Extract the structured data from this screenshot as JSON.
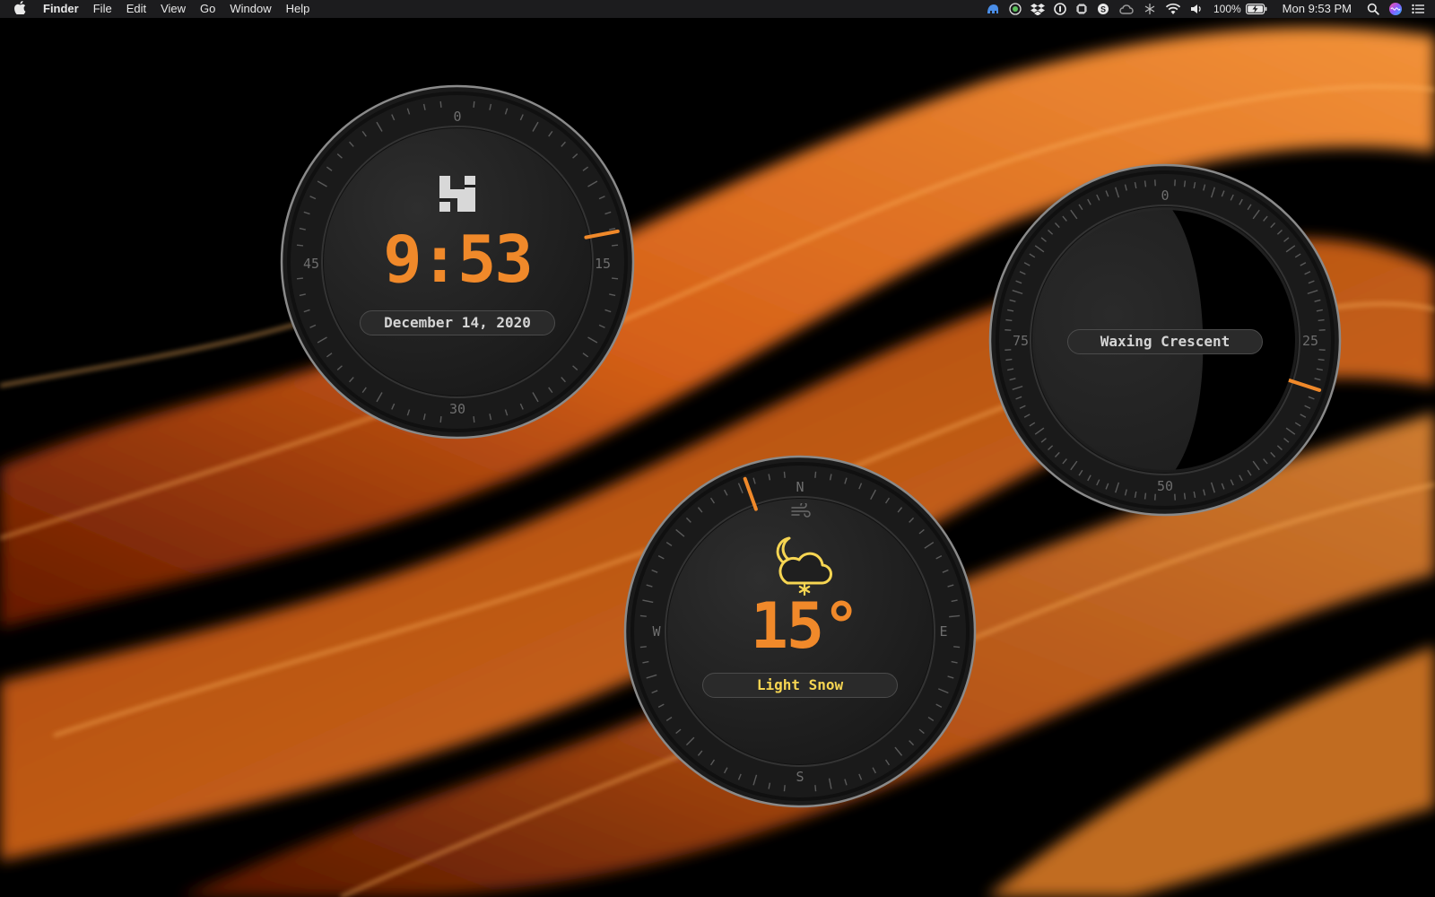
{
  "menubar": {
    "app_name": "Finder",
    "items": [
      "File",
      "Edit",
      "View",
      "Go",
      "Window",
      "Help"
    ],
    "status": {
      "battery": "100%",
      "datetime": "Mon 9:53 PM"
    },
    "status_icons": [
      "tunnelblick-icon",
      "istat-icon",
      "dropbox-icon",
      "1password-icon",
      "cpu-icon",
      "skype-icon",
      "creative-cloud-icon",
      "bartender-icon",
      "wifi-icon",
      "volume-icon",
      "battery-icon",
      "search-icon",
      "siri-icon",
      "control-center-icon"
    ]
  },
  "clock_widget": {
    "time": "9:53",
    "date": "December 14, 2020",
    "dial_labels": [
      "0",
      "15",
      "30",
      "45"
    ],
    "progress_fraction": 0.22,
    "logo": "h-logo-icon"
  },
  "moon_widget": {
    "phase_name": "Waxing Crescent",
    "dial_labels": [
      "0",
      "25",
      "50",
      "75"
    ],
    "progress_fraction": 0.3
  },
  "weather_widget": {
    "temperature": "15°",
    "condition": "Light Snow",
    "dial_labels": [
      "N",
      "E",
      "S",
      "W"
    ],
    "wind_direction_fraction": 0.945,
    "icon": "moon-cloud-snow-icon"
  },
  "colors": {
    "accent": "#f0892a",
    "weather_yellow": "#f6d552",
    "dial_bg": "#1b1b1b",
    "face_bg": "#252525"
  }
}
